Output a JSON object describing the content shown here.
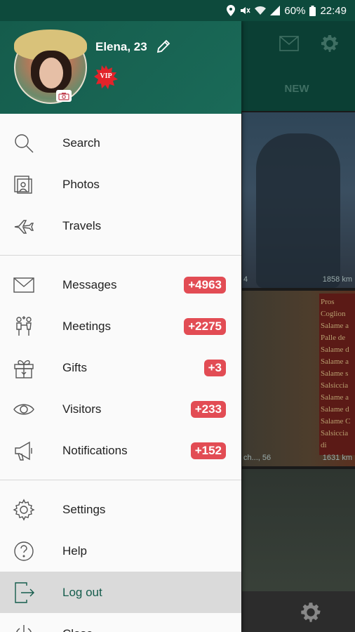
{
  "status_bar": {
    "battery": "60%",
    "time": "22:49"
  },
  "background": {
    "tab_new": "NEW",
    "photo1_caption_left": "4",
    "photo1_caption_right": "1858 km",
    "photo2_caption_left": "ch..., 56",
    "photo2_caption_right": "1631 km",
    "sign_lines": [
      "Pros",
      "Coglion",
      "Salame a",
      "Palle de",
      "Salame d",
      "Salame a",
      "Salame s",
      "Salsiccia",
      "Salame a",
      "Salame d",
      "Salame C",
      "Salsiccia di"
    ]
  },
  "user": {
    "name": "Elena, 23",
    "vip_label": "VIP"
  },
  "menu": {
    "section1": [
      {
        "label": "Search",
        "icon": "search-icon"
      },
      {
        "label": "Photos",
        "icon": "photos-icon"
      },
      {
        "label": "Travels",
        "icon": "plane-icon"
      }
    ],
    "section2": [
      {
        "label": "Messages",
        "icon": "envelope-icon",
        "badge": "+4963"
      },
      {
        "label": "Meetings",
        "icon": "couple-icon",
        "badge": "+2275"
      },
      {
        "label": "Gifts",
        "icon": "gift-icon",
        "badge": "+3"
      },
      {
        "label": "Visitors",
        "icon": "eye-icon",
        "badge": "+233"
      },
      {
        "label": "Notifications",
        "icon": "megaphone-icon",
        "badge": "+152"
      }
    ],
    "section3": [
      {
        "label": "Settings",
        "icon": "gear-icon"
      },
      {
        "label": "Help",
        "icon": "help-icon"
      },
      {
        "label": "Log out",
        "icon": "logout-icon",
        "active": true
      },
      {
        "label": "Close",
        "icon": "power-icon"
      }
    ]
  },
  "colors": {
    "header_green": "#155c4c",
    "badge_red": "#e24c54",
    "active_bg": "#dadada"
  }
}
